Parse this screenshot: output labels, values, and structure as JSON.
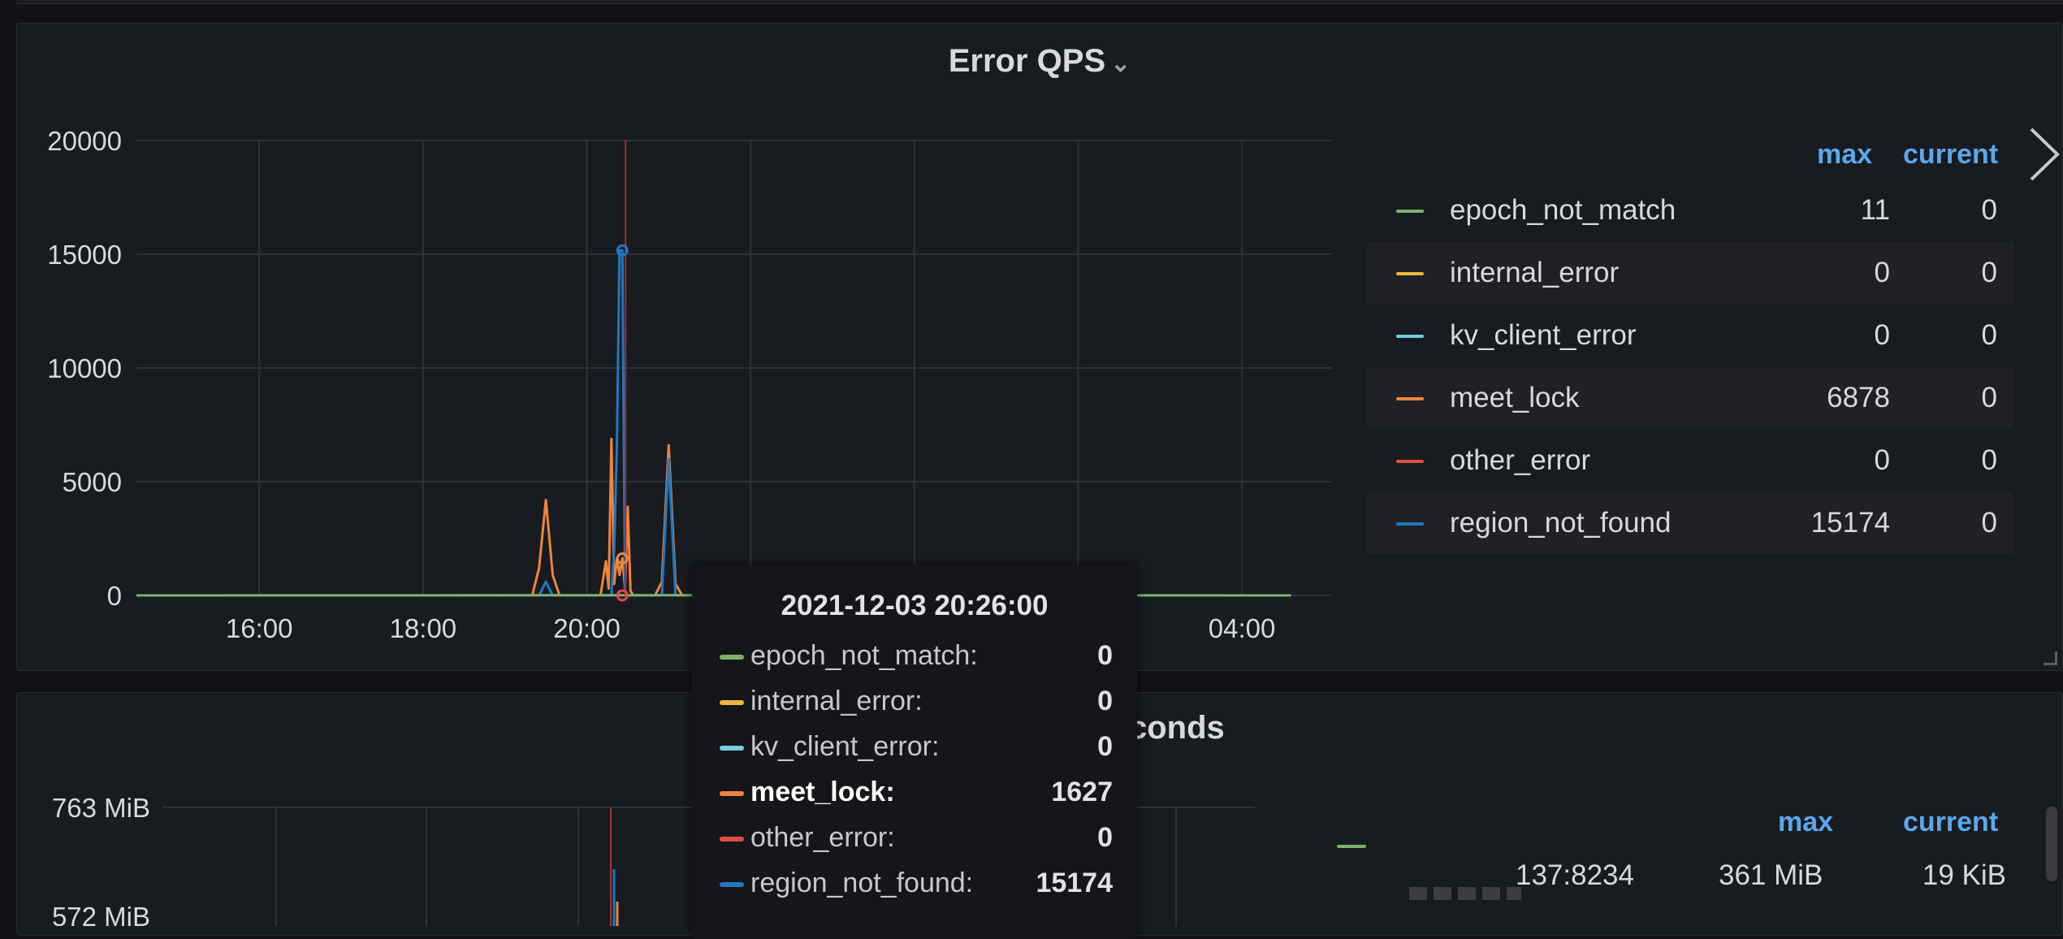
{
  "panel1": {
    "title": "Error QPS",
    "legend": {
      "headers": {
        "max": "max",
        "current": "current"
      },
      "rows": [
        {
          "name": "epoch_not_match",
          "max": "11",
          "current": "0",
          "color": "#7eb26d"
        },
        {
          "name": "internal_error",
          "max": "0",
          "current": "0",
          "color": "#eab839"
        },
        {
          "name": "kv_client_error",
          "max": "0",
          "current": "0",
          "color": "#6ed0e0"
        },
        {
          "name": "meet_lock",
          "max": "6878",
          "current": "0",
          "color": "#ef843c"
        },
        {
          "name": "other_error",
          "max": "0",
          "current": "0",
          "color": "#e24d42"
        },
        {
          "name": "region_not_found",
          "max": "15174",
          "current": "0",
          "color": "#1f78c1"
        }
      ]
    }
  },
  "tooltip": {
    "title": "2021-12-03 20:26:00",
    "rows": [
      {
        "name": "epoch_not_match:",
        "value": "0",
        "color": "#7eb26d"
      },
      {
        "name": "internal_error:",
        "value": "0",
        "color": "#eab839"
      },
      {
        "name": "kv_client_error:",
        "value": "0",
        "color": "#6ed0e0"
      },
      {
        "name": "meet_lock:",
        "value": "1627",
        "color": "#ef843c"
      },
      {
        "name": "other_error:",
        "value": "0",
        "color": "#e24d42"
      },
      {
        "name": "region_not_found:",
        "value": "15174",
        "color": "#1f78c1"
      }
    ]
  },
  "panel2": {
    "title_visible": "conds",
    "legend": {
      "headers": {
        "max": "max",
        "current": "current"
      },
      "rows": [
        {
          "name": "137:8234",
          "max": "361 MiB",
          "current": "19 KiB",
          "color": "#7eb26d"
        }
      ]
    },
    "y_ticks": [
      "763 MiB",
      "572 MiB"
    ]
  },
  "chart_data": {
    "type": "line",
    "title": "Error QPS",
    "x_ticks": [
      "16:00",
      "18:00",
      "20:00",
      "",
      "04:00"
    ],
    "y_ticks": [
      "0",
      "5000",
      "10000",
      "15000",
      "20000"
    ],
    "ylim": [
      0,
      20000
    ],
    "xlim_hours": [
      14.5,
      29.1
    ],
    "crosshair_time": "20:26",
    "grid": true,
    "legend_placement": "right",
    "series": [
      {
        "name": "meet_lock",
        "color": "#ef843c",
        "x": [
          "14:30",
          "19:20",
          "19:25",
          "19:30",
          "19:35",
          "19:40",
          "20:10",
          "20:14",
          "20:16",
          "20:18",
          "20:20",
          "20:22",
          "20:24",
          "20:26",
          "20:28",
          "20:30",
          "20:32",
          "20:34",
          "20:38",
          "20:50",
          "20:55",
          "21:00",
          "21:05",
          "21:10",
          "04:36"
        ],
        "y": [
          0,
          0,
          1200,
          4200,
          900,
          0,
          0,
          1500,
          300,
          6878,
          500,
          1627,
          900,
          1627,
          300,
          3900,
          200,
          0,
          0,
          0,
          600,
          6600,
          500,
          0,
          0
        ]
      },
      {
        "name": "region_not_found",
        "color": "#1f78c1",
        "x": [
          "14:30",
          "19:25",
          "19:30",
          "19:35",
          "20:18",
          "20:20",
          "20:22",
          "20:24",
          "20:26",
          "20:28",
          "20:30",
          "20:55",
          "21:00",
          "21:05",
          "21:10",
          "04:36"
        ],
        "y": [
          0,
          0,
          600,
          0,
          0,
          2000,
          6500,
          15174,
          15174,
          200,
          0,
          0,
          6000,
          0,
          0,
          0
        ]
      },
      {
        "name": "epoch_not_match",
        "color": "#7eb26d",
        "x": [
          "14:30",
          "20:24",
          "04:36"
        ],
        "y": [
          0,
          11,
          0
        ]
      }
    ]
  }
}
